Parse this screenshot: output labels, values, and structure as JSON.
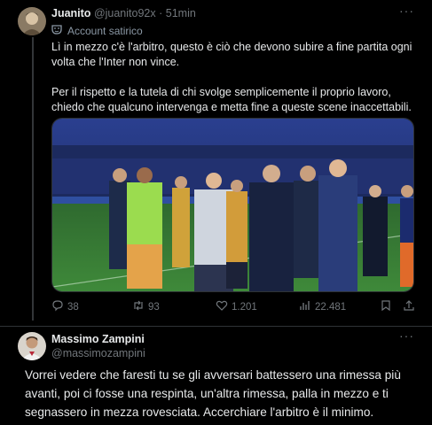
{
  "tweet1": {
    "display_name": "Juanito",
    "handle": "@juanito92x",
    "separator": "·",
    "time": "51min",
    "more": "···",
    "badge": "Account satirico",
    "paragraph1": "Lì in mezzo c'è l'arbitro, questo è ciò che devono subire a fine partita ogni volta che l'Inter non vince.",
    "paragraph2": "Per il rispetto e la tutela di chi svolge semplicemente il proprio lavoro, chiedo che qualcuno intervenga e metta fine a queste scene inaccettabili.",
    "actions": {
      "replies": "38",
      "retweets": "93",
      "likes": "1.201",
      "views": "22.481"
    }
  },
  "tweet2": {
    "display_name": "Massimo Zampini",
    "handle": "@massimozampini",
    "more": "···",
    "text": "Vorrei vedere che faresti tu se gli avversari battessero una rimessa più avanti, poi ci fosse una respinta, un'altra rimessa, palla in mezzo e ti segnassero in mezza rovesciata. Accerchiare l'arbitro è il minimo."
  },
  "colors": {
    "background": "#000000",
    "text": "#e7e9ea",
    "muted": "#71767b",
    "divider": "#2f3336"
  }
}
